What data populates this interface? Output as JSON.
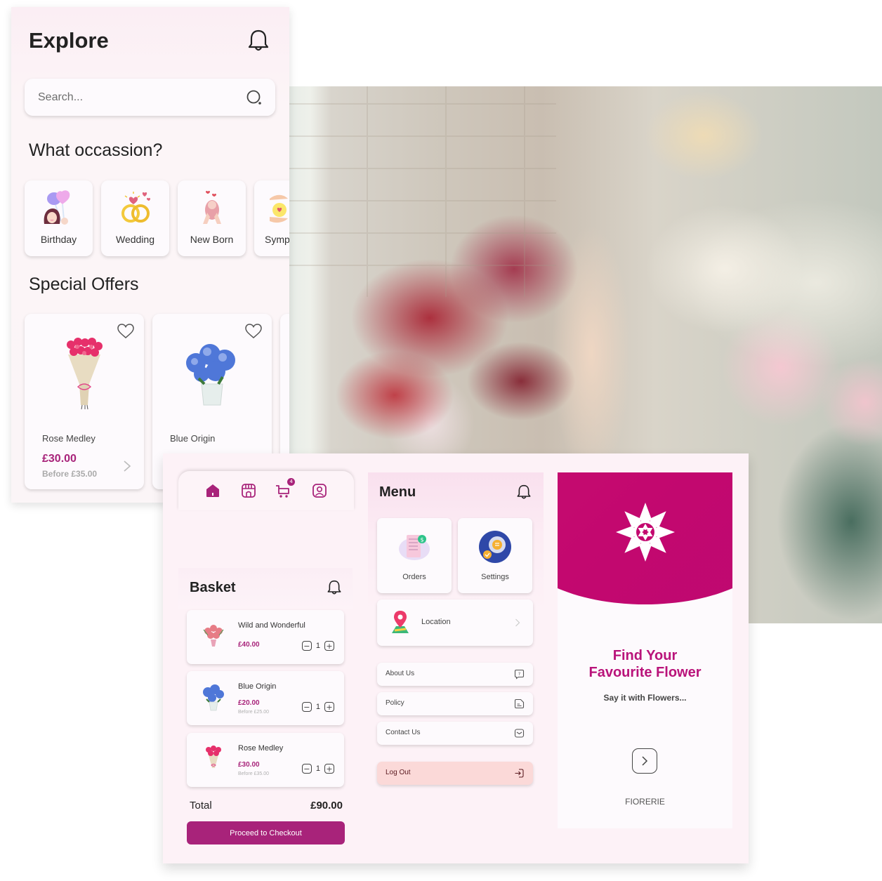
{
  "explore": {
    "title": "Explore",
    "search": {
      "placeholder": "Search...",
      "value": ""
    },
    "occasion_heading": "What occassion?",
    "occasions": [
      {
        "label": "Birthday",
        "icon": "birthday-balloons-icon"
      },
      {
        "label": "Wedding",
        "icon": "wedding-rings-icon"
      },
      {
        "label": "New Born",
        "icon": "newborn-baby-icon"
      },
      {
        "label": "Sympathy",
        "icon": "sympathy-hands-icon"
      }
    ],
    "offers_heading": "Special Offers",
    "offers": [
      {
        "name": "Rose Medley",
        "price": "£30.00",
        "before": "Before £35.00",
        "image": "rose-bouquet"
      },
      {
        "name": "Blue Origin",
        "price": "",
        "before": "",
        "image": "blue-hydrangea-vase"
      }
    ]
  },
  "navbar": {
    "items": [
      {
        "name": "home",
        "icon": "home-icon",
        "active": true
      },
      {
        "name": "shop",
        "icon": "store-icon"
      },
      {
        "name": "cart",
        "icon": "cart-icon",
        "badge": "4"
      },
      {
        "name": "profile",
        "icon": "profile-icon"
      }
    ]
  },
  "basket": {
    "title": "Basket",
    "items": [
      {
        "name": "Wild and Wonderful",
        "price": "£40.00",
        "before": "",
        "qty": "1"
      },
      {
        "name": "Blue Origin",
        "price": "£20.00",
        "before": "Before £25.00",
        "qty": "1"
      },
      {
        "name": "Rose Medley",
        "price": "£30.00",
        "before": "Before £35.00",
        "qty": "1"
      }
    ],
    "total_label": "Total",
    "total_value": "£90.00",
    "checkout_label": "Proceed to Checkout"
  },
  "menu": {
    "title": "Menu",
    "tiles": [
      {
        "label": "Orders",
        "icon": "orders-receipt-icon"
      },
      {
        "label": "Settings",
        "icon": "settings-gear-icon"
      }
    ],
    "location_label": "Location",
    "rows": [
      {
        "label": "About Us",
        "icon": "help-bubble-icon"
      },
      {
        "label": "Policy",
        "icon": "document-icon"
      },
      {
        "label": "Contact Us",
        "icon": "mail-icon"
      }
    ],
    "logout_label": "Log Out"
  },
  "splash": {
    "title_line1": "Find Your",
    "title_line2": "Favourite Flower",
    "subtitle": "Say it with Flowers...",
    "brand": "FIORERIE"
  },
  "colors": {
    "brand": "#a8237a",
    "splash_magenta": "#c3086f",
    "logout_bg": "#fbd9d8",
    "panel_bg": "#fdf2f7"
  }
}
